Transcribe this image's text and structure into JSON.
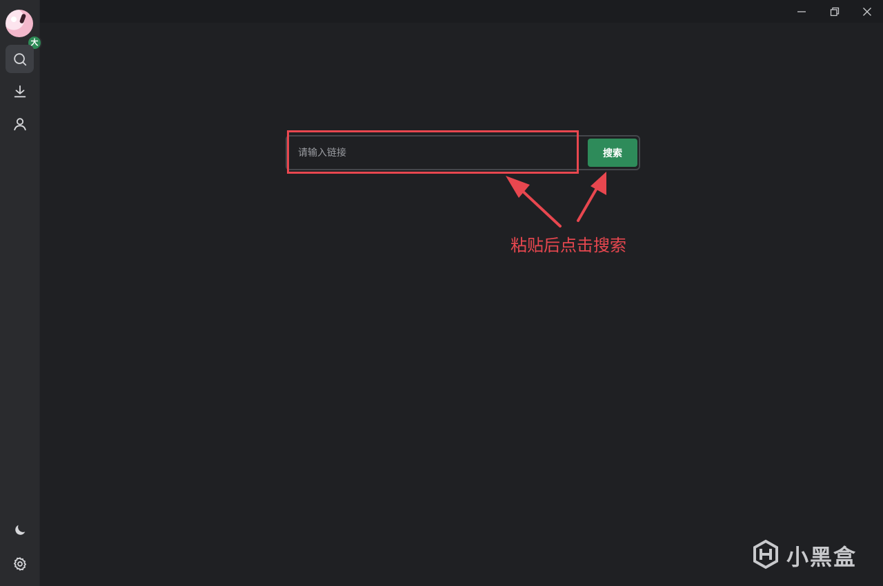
{
  "sidebar": {
    "avatar_badge": "大",
    "items": [
      {
        "name": "search",
        "icon": "search-icon",
        "active": true
      },
      {
        "name": "download",
        "icon": "download-icon",
        "active": false
      },
      {
        "name": "user",
        "icon": "user-icon",
        "active": false
      }
    ],
    "bottom_items": [
      {
        "name": "theme",
        "icon": "moon-icon"
      },
      {
        "name": "settings",
        "icon": "gear-icon"
      }
    ]
  },
  "window_controls": [
    "minimize-icon",
    "restore-icon",
    "close-icon"
  ],
  "search": {
    "placeholder": "请输入链接",
    "value": "",
    "button_label": "搜索"
  },
  "annotation": {
    "text": "粘贴后点击搜索",
    "color": "#e8474f"
  },
  "watermark": {
    "text": "小黑盒"
  },
  "colors": {
    "accent": "#2e8b5a",
    "background": "#1f2023",
    "sidebar": "#2a2b2e"
  }
}
